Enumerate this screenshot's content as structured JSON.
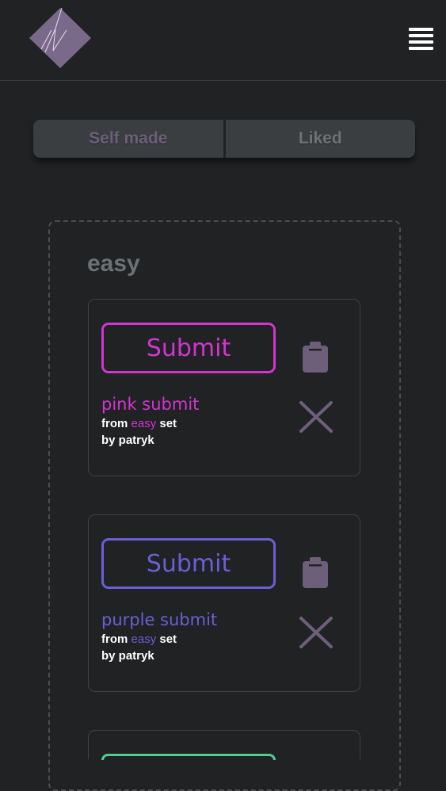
{
  "colors": {
    "background": "#202224",
    "logo": "#7a6a8a",
    "icon": "#6d5f79",
    "pink": "#d335d0",
    "purple": "#6b5fd6",
    "green": "#4fce8f"
  },
  "header": {
    "logo_icon": "diamond-logo",
    "menu_icon": "hamburger-menu-icon"
  },
  "tabs": [
    {
      "label": "Self made"
    },
    {
      "label": "Liked"
    }
  ],
  "set": {
    "title": "easy",
    "cards": [
      {
        "button_label": "Submit",
        "name": "pink submit",
        "from_prefix": "from",
        "set_name": "easy",
        "set_suffix": "set",
        "author_line": "by patryk",
        "accent": "#d335d0"
      },
      {
        "button_label": "Submit",
        "name": "purple submit",
        "from_prefix": "from",
        "set_name": "easy",
        "set_suffix": "set",
        "author_line": "by patryk",
        "accent": "#6b5fd6"
      }
    ]
  }
}
